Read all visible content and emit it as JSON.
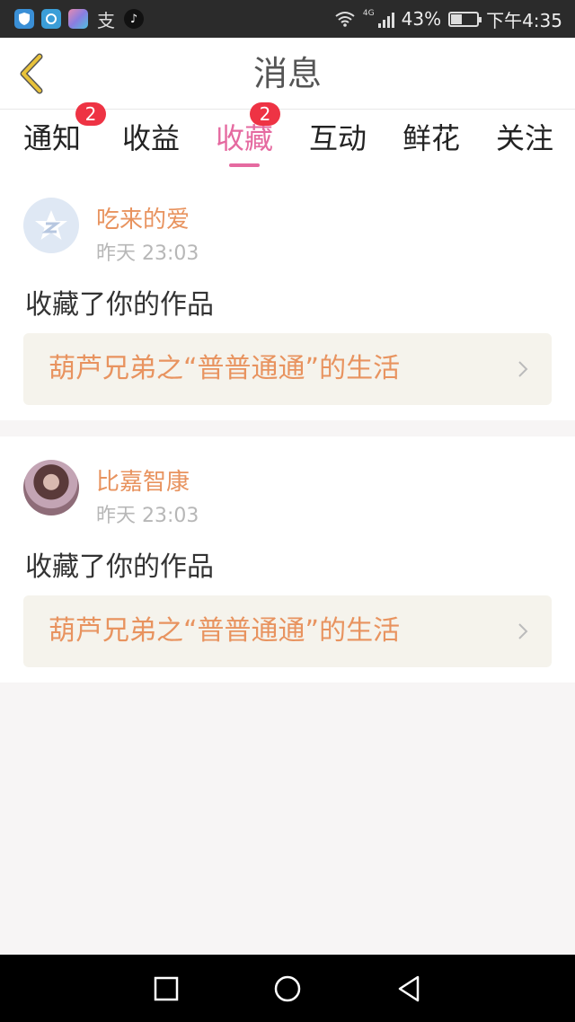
{
  "status_bar": {
    "apps": [
      "shield-app-icon",
      "browser-app-icon",
      "gallery-app-icon",
      "alipay-app-icon",
      "tiktok-app-icon"
    ],
    "alipay_glyph": "支",
    "tiktok_glyph": "♪",
    "network": "4G",
    "battery": "43%",
    "battery_level": 0.43,
    "time": "下午4:35"
  },
  "header": {
    "title": "消息"
  },
  "tabs": [
    {
      "label": "通知",
      "badge": "2",
      "active": false
    },
    {
      "label": "收益",
      "badge": null,
      "active": false
    },
    {
      "label": "收藏",
      "badge": "2",
      "active": true
    },
    {
      "label": "互动",
      "badge": null,
      "active": false
    },
    {
      "label": "鲜花",
      "badge": null,
      "active": false
    },
    {
      "label": "关注",
      "badge": null,
      "active": false
    }
  ],
  "messages": [
    {
      "username": "吃来的爱",
      "time": "昨天 23:03",
      "action": "收藏了你的作品",
      "work_title": "葫芦兄弟之“普普通通”的生活"
    },
    {
      "username": "比嘉智康",
      "time": "昨天 23:03",
      "action": "收藏了你的作品",
      "work_title": "葫芦兄弟之“普普通通”的生活"
    }
  ],
  "colors": {
    "accent_pink": "#e56aa0",
    "username_orange": "#e8935f",
    "badge_red": "#ee3344",
    "back_arrow": "#e8c23a"
  }
}
